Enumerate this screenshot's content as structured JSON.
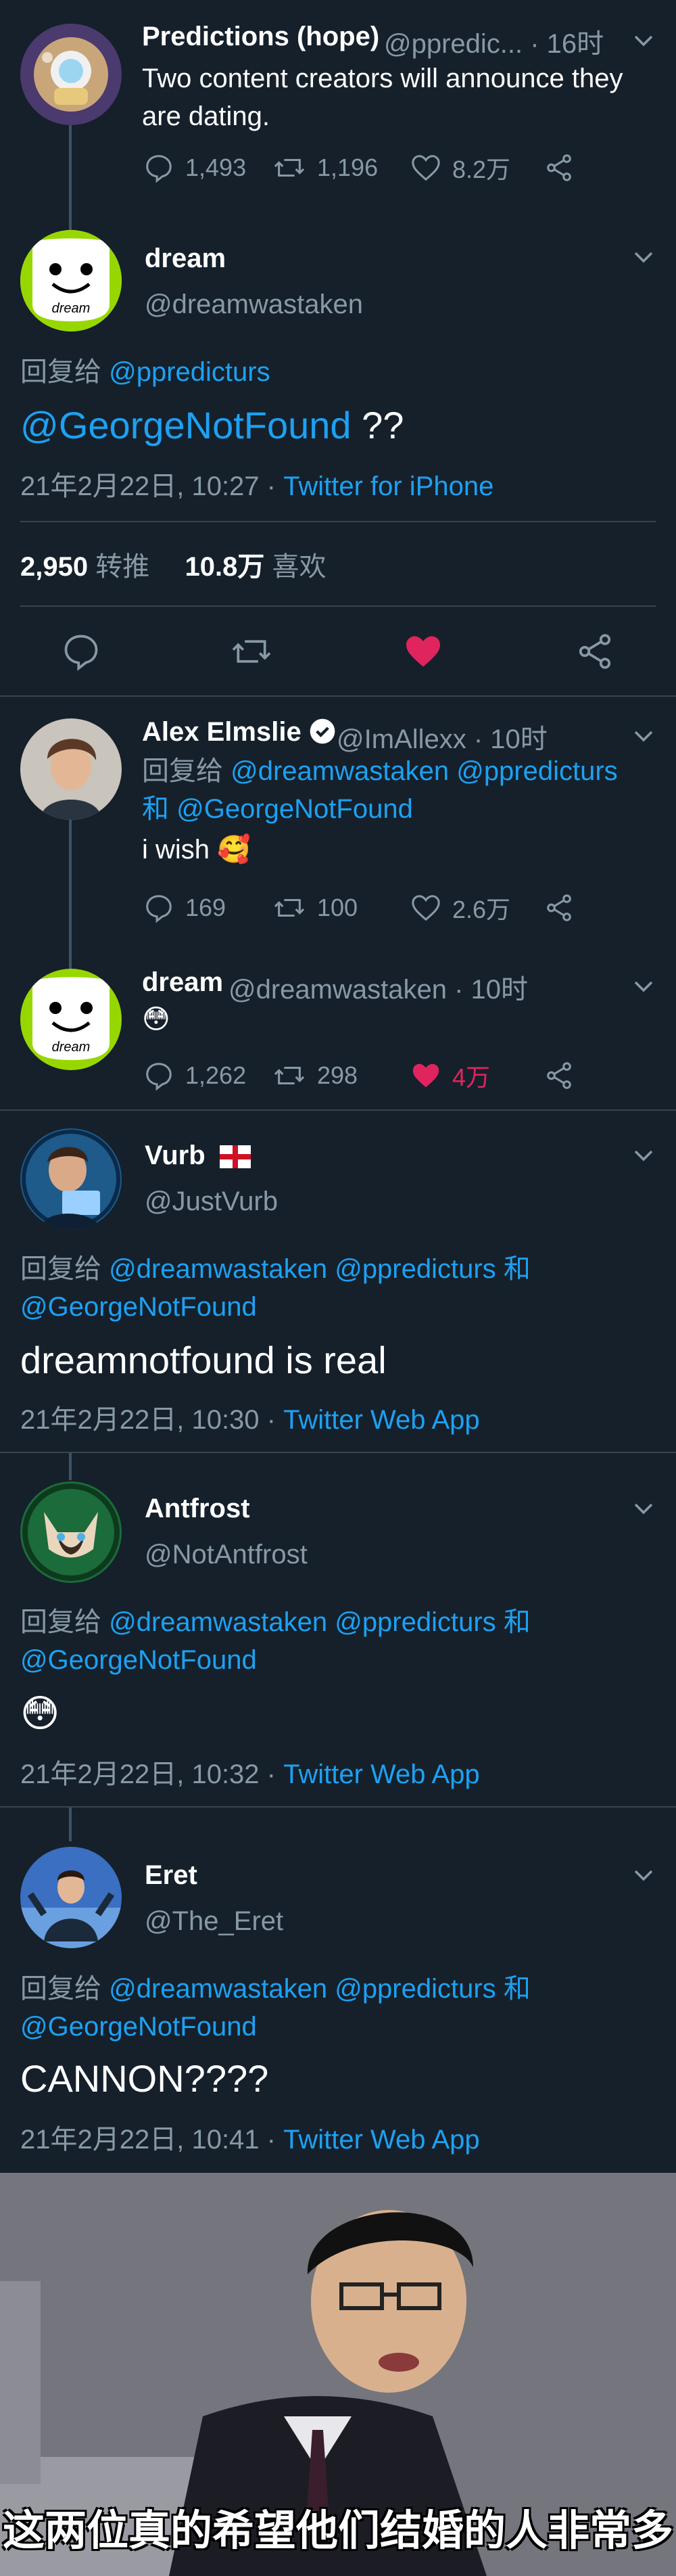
{
  "tweet1": {
    "name": "Predictions (hope)",
    "handle_time": "@ppredic... · 16时",
    "text": "Two content creators will announce they are dating.",
    "replies": "1,493",
    "retweets": "1,196",
    "likes": "8.2万"
  },
  "main": {
    "name": "dream",
    "handle": "@dreamwastaken",
    "reply_prefix": "回复给",
    "reply_to": "@ppredicturs",
    "mention": "@GeorgeNotFound",
    "text_suffix": " ??",
    "date": "21年2月22日, 10:27 · ",
    "source": "Twitter for iPhone",
    "retweet_count": "2,950",
    "retweet_label": "转推",
    "like_count": "10.8万",
    "like_label": "喜欢",
    "avatar_text": "dream"
  },
  "reply1": {
    "name": "Alex Elmslie",
    "handle_time": "@ImAllexx · 10时",
    "reply_prefix": "回复给",
    "reply_to_1": "@dreamwastaken @ppredicturs",
    "and_word": "和",
    "reply_to_2": "@GeorgeNotFound",
    "text": "i wish 🥰",
    "replies": "169",
    "retweets": "100",
    "likes": "2.6万"
  },
  "reply2": {
    "name": "dream",
    "handle_time": "@dreamwastaken · 10时",
    "text": "😳",
    "replies": "1,262",
    "retweets": "298",
    "likes": "4万",
    "like_color": "#e0245e",
    "avatar_text": "dream"
  },
  "vurb": {
    "name": "Vurb",
    "handle": "@JustVurb",
    "reply_prefix": "回复给",
    "reply_to_1": "@dreamwastaken @ppredicturs",
    "and_word": "和",
    "reply_to_2": "@GeorgeNotFound",
    "text": "dreamnotfound is real",
    "date": "21年2月22日, 10:30 · ",
    "source": "Twitter Web App"
  },
  "antfrost": {
    "name": "Antfrost",
    "handle": "@NotAntfrost",
    "reply_prefix": "回复给",
    "reply_to_1": "@dreamwastaken @ppredicturs",
    "and_word": "和",
    "reply_to_2": "@GeorgeNotFound",
    "text": "😳",
    "date": "21年2月22日, 10:32 · ",
    "source": "Twitter Web App"
  },
  "eret": {
    "name": "Eret",
    "handle": "@The_Eret",
    "reply_prefix": "回复给",
    "reply_to_1": "@dreamwastaken @ppredicturs",
    "and_word": "和",
    "reply_to_2": "@GeorgeNotFound",
    "text": "CANNON????",
    "date": "21年2月22日, 10:41 · ",
    "source": "Twitter Web App"
  },
  "meme": {
    "caption": "这两位真的希望他们结婚的人非常多"
  },
  "colors": {
    "background": "#15202b",
    "link": "#1da1f2",
    "muted": "#8899a6",
    "like": "#e0245e",
    "dream_green": "#97d700"
  }
}
